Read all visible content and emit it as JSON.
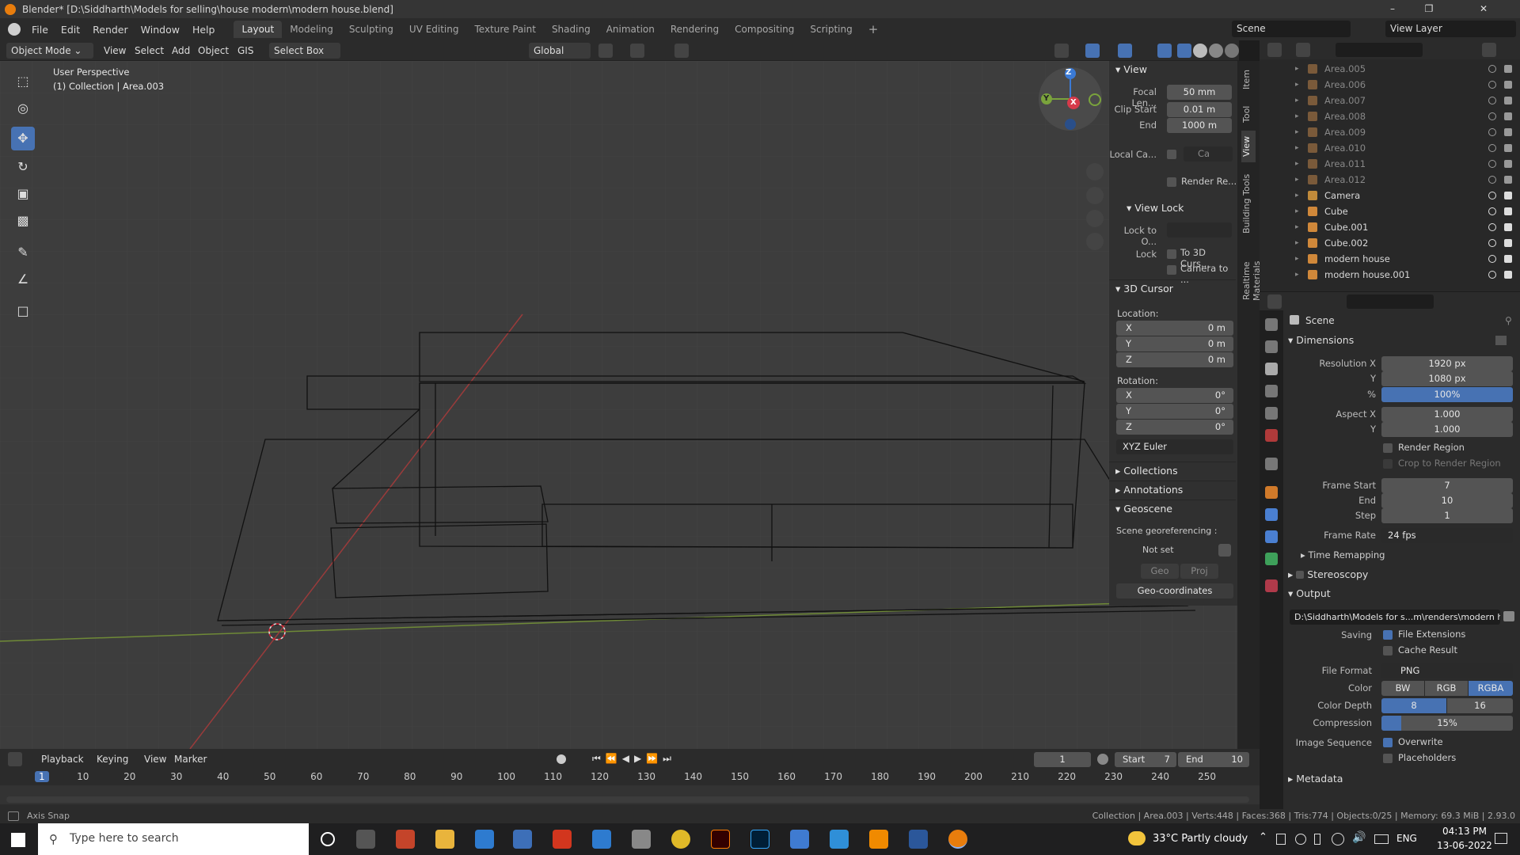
{
  "window": {
    "title": "Blender* [D:\\Siddharth\\Models for selling\\house modern\\modern house.blend]"
  },
  "menus": [
    "File",
    "Edit",
    "Render",
    "Window",
    "Help"
  ],
  "workspaces": [
    "Layout",
    "Modeling",
    "Sculpting",
    "UV Editing",
    "Texture Paint",
    "Shading",
    "Animation",
    "Rendering",
    "Compositing",
    "Scripting"
  ],
  "scene": {
    "label": "Scene",
    "view_layer": "View Layer"
  },
  "header": {
    "mode": "Object Mode",
    "view": "View",
    "select": "Select",
    "add": "Add",
    "object": "Object",
    "gis": "GIS",
    "select_box": "Select Box",
    "orientation": "Global"
  },
  "viewport": {
    "perspective": "User Perspective",
    "collection": "(1) Collection | Area.003",
    "gizmo": {
      "x": "X",
      "y": "Y",
      "z": "Z"
    }
  },
  "npanel": {
    "tabs": [
      "Item",
      "Tool",
      "View",
      "Building Tools",
      "Realtime Materials"
    ],
    "view_header": "View",
    "focal_length_label": "Focal Len...",
    "focal_length": "50 mm",
    "clip_start_label": "Clip Start",
    "clip_start": "0.01 m",
    "clip_end_label": "End",
    "clip_end": "1000 m",
    "local_camera_label": "Local Ca...",
    "local_camera_value": "Ca",
    "render_region_label": "Render Re...",
    "view_lock_header": "View Lock",
    "lock_to_object_label": "Lock to O...",
    "lock_label": "Lock",
    "lock_3d_cursor": "To 3D Curs...",
    "camera_to_view": "Camera to ...",
    "cursor_header": "3D Cursor",
    "location_label": "Location:",
    "loc_x": "0 m",
    "loc_y": "0 m",
    "loc_z": "0 m",
    "rotation_label": "Rotation:",
    "rot_x": "0°",
    "rot_y": "0°",
    "rot_z": "0°",
    "axis_x": "X",
    "axis_y": "Y",
    "axis_z": "Z",
    "rotation_mode": "XYZ Euler",
    "collections": "Collections",
    "annotations": "Annotations",
    "geoscene": "Geoscene",
    "georef_label": "Scene georeferencing :",
    "not_set": "Not set",
    "geo": "Geo",
    "proj": "Proj",
    "geo_coordinates": "Geo-coordinates"
  },
  "outliner": {
    "items": [
      {
        "name": "Area.005",
        "dim": true
      },
      {
        "name": "Area.006",
        "dim": true
      },
      {
        "name": "Area.007",
        "dim": true
      },
      {
        "name": "Area.008",
        "dim": true
      },
      {
        "name": "Area.009",
        "dim": true
      },
      {
        "name": "Area.010",
        "dim": true
      },
      {
        "name": "Area.011",
        "dim": true
      },
      {
        "name": "Area.012",
        "dim": true
      },
      {
        "name": "Camera",
        "dim": false
      },
      {
        "name": "Cube",
        "dim": false
      },
      {
        "name": "Cube.001",
        "dim": false
      },
      {
        "name": "Cube.002",
        "dim": false
      },
      {
        "name": "modern house",
        "dim": false
      },
      {
        "name": "modern house.001",
        "dim": false
      }
    ]
  },
  "properties": {
    "context": "Scene",
    "dimensions": "Dimensions",
    "resolution_x_label": "Resolution X",
    "resolution_x": "1920 px",
    "y_label": "Y",
    "resolution_y": "1080 px",
    "percent_label": "%",
    "resolution_pct": "100%",
    "aspect_x_label": "Aspect X",
    "aspect_x": "1.000",
    "aspect_y": "1.000",
    "render_region": "Render Region",
    "crop_region": "Crop to Render Region",
    "frame_start_label": "Frame Start",
    "frame_start": "7",
    "end_label": "End",
    "frame_end": "10",
    "step_label": "Step",
    "frame_step": "1",
    "frame_rate_label": "Frame Rate",
    "frame_rate": "24 fps",
    "time_remapping": "Time Remapping",
    "stereoscopy": "Stereoscopy",
    "output": "Output",
    "output_path": "D:\\Siddharth\\Models for s...m\\renders\\modern house",
    "saving_label": "Saving",
    "file_extensions": "File Extensions",
    "cache_result": "Cache Result",
    "file_format_label": "File Format",
    "file_format": "PNG",
    "color_label": "Color",
    "color_modes": [
      "BW",
      "RGB",
      "RGBA"
    ],
    "color_depth_label": "Color Depth",
    "color_depths": [
      "8",
      "16"
    ],
    "compression_label": "Compression",
    "compression": "15%",
    "compression_value": 0.15,
    "image_sequence_label": "Image Sequence",
    "overwrite": "Overwrite",
    "placeholders": "Placeholders",
    "metadata": "Metadata"
  },
  "timeline": {
    "menus": [
      "Playback",
      "Keying",
      "View",
      "Marker"
    ],
    "current_frame": "1",
    "start_label": "Start",
    "start": "7",
    "end_label": "End",
    "end": "10",
    "ruler": [
      "1",
      "10",
      "20",
      "30",
      "40",
      "50",
      "60",
      "70",
      "80",
      "90",
      "100",
      "110",
      "120",
      "130",
      "140",
      "150",
      "160",
      "170",
      "180",
      "190",
      "200",
      "210",
      "220",
      "230",
      "240",
      "250"
    ]
  },
  "status": {
    "left": "Axis Snap",
    "right": "Collection | Area.003 | Verts:448 | Faces:368 | Tris:774 | Objects:0/25 | Memory: 69.3 MiB | 2.93.0"
  },
  "taskbar": {
    "search_placeholder": "Type here to search",
    "weather": "33°C  Partly cloudy",
    "lang": "ENG",
    "time": "04:13 PM",
    "date": "13-06-2022"
  }
}
